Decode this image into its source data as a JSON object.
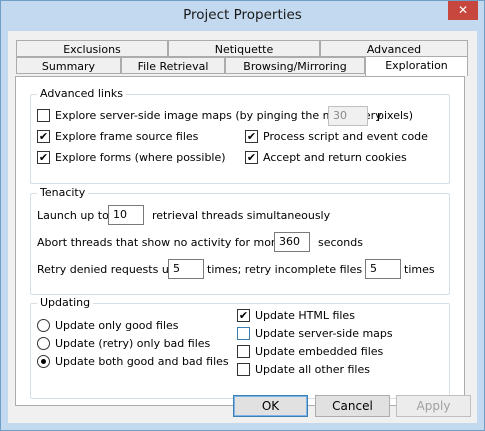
{
  "window": {
    "title": "Project Properties",
    "close_glyph": "✕"
  },
  "tabs": {
    "row1": [
      "Exclusions",
      "Netiquette",
      "Advanced"
    ],
    "row2": [
      "Summary",
      "File Retrieval",
      "Browsing/Mirroring",
      "Exploration"
    ],
    "active": "Exploration"
  },
  "advanced_links": {
    "title": "Advanced links",
    "server_image_maps": {
      "label": "Explore server-side image maps (by pinging the map every",
      "checked": false,
      "value": "30",
      "suffix": "pixels)"
    },
    "frame_source": {
      "label": "Explore frame source files",
      "checked": true
    },
    "process_script": {
      "label": "Process script and event code",
      "checked": true
    },
    "forms": {
      "label": "Explore forms (where possible)",
      "checked": true
    },
    "cookies": {
      "label": "Accept and return cookies",
      "checked": true
    }
  },
  "tenacity": {
    "title": "Tenacity",
    "launch_prefix": "Launch up to",
    "launch_value": "10",
    "launch_suffix": "retrieval threads simultaneously",
    "abort_prefix": "Abort threads that show no activity for more than",
    "abort_value": "360",
    "abort_suffix": "seconds",
    "retry_prefix": "Retry denied requests up to",
    "retry_denied_value": "5",
    "retry_middle": "times; retry incomplete files up to",
    "retry_incomplete_value": "5",
    "retry_suffix": "times"
  },
  "updating": {
    "title": "Updating",
    "radios": [
      {
        "label": "Update only good files",
        "selected": false
      },
      {
        "label": "Update (retry) only bad files",
        "selected": false
      },
      {
        "label": "Update both good and bad files",
        "selected": true
      }
    ],
    "checks": [
      {
        "label": "Update HTML files",
        "checked": true
      },
      {
        "label": "Update server-side maps",
        "checked": false
      },
      {
        "label": "Update embedded files",
        "checked": false
      },
      {
        "label": "Update all other files",
        "checked": false
      }
    ]
  },
  "buttons": {
    "ok": "OK",
    "cancel": "Cancel",
    "apply": "Apply"
  },
  "check_glyph": "✔"
}
